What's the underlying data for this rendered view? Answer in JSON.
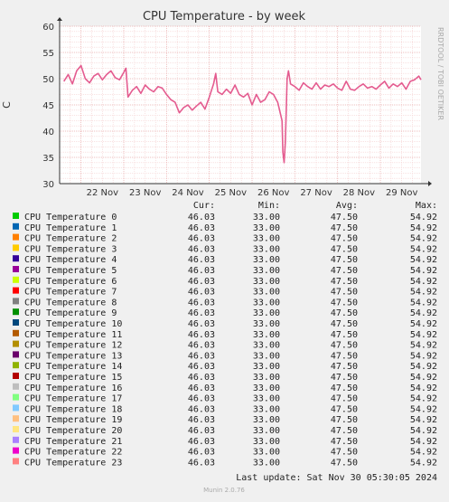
{
  "chart_data": {
    "type": "line",
    "title": "CPU Temperature - by week",
    "ylabel": "C",
    "side_label": "RRDTOOL / TOBI OETIKER",
    "ylim": [
      30,
      60
    ],
    "yticks": [
      30,
      35,
      40,
      45,
      50,
      55,
      60
    ],
    "x_categories": [
      "22 Nov",
      "23 Nov",
      "24 Nov",
      "25 Nov",
      "26 Nov",
      "27 Nov",
      "28 Nov",
      "29 Nov"
    ],
    "grid": true,
    "series_color": "#e45b8f",
    "series": [
      {
        "name": "CPU Temperature 23",
        "points": [
          [
            21.6,
            49.5
          ],
          [
            21.7,
            50.8
          ],
          [
            21.8,
            49.0
          ],
          [
            21.9,
            51.5
          ],
          [
            22.0,
            52.5
          ],
          [
            22.1,
            50.0
          ],
          [
            22.2,
            49.2
          ],
          [
            22.3,
            50.5
          ],
          [
            22.4,
            51.0
          ],
          [
            22.5,
            49.8
          ],
          [
            22.6,
            50.8
          ],
          [
            22.7,
            51.5
          ],
          [
            22.8,
            50.2
          ],
          [
            22.9,
            49.8
          ],
          [
            23.0,
            51.2
          ],
          [
            23.05,
            52.0
          ],
          [
            23.1,
            46.5
          ],
          [
            23.2,
            47.8
          ],
          [
            23.3,
            48.5
          ],
          [
            23.4,
            47.2
          ],
          [
            23.5,
            48.8
          ],
          [
            23.6,
            48.0
          ],
          [
            23.7,
            47.5
          ],
          [
            23.8,
            48.5
          ],
          [
            23.9,
            48.2
          ],
          [
            24.0,
            47.0
          ],
          [
            24.1,
            46.0
          ],
          [
            24.2,
            45.5
          ],
          [
            24.3,
            43.5
          ],
          [
            24.4,
            44.5
          ],
          [
            24.5,
            45.0
          ],
          [
            24.6,
            44.0
          ],
          [
            24.7,
            44.8
          ],
          [
            24.8,
            45.5
          ],
          [
            24.9,
            44.2
          ],
          [
            25.0,
            46.5
          ],
          [
            25.1,
            49.0
          ],
          [
            25.15,
            51.0
          ],
          [
            25.2,
            47.5
          ],
          [
            25.3,
            47.0
          ],
          [
            25.4,
            48.0
          ],
          [
            25.5,
            47.2
          ],
          [
            25.6,
            48.8
          ],
          [
            25.7,
            47.0
          ],
          [
            25.8,
            46.5
          ],
          [
            25.9,
            47.2
          ],
          [
            26.0,
            45.0
          ],
          [
            26.1,
            47.0
          ],
          [
            26.2,
            45.5
          ],
          [
            26.3,
            46.0
          ],
          [
            26.4,
            47.5
          ],
          [
            26.5,
            47.0
          ],
          [
            26.6,
            45.5
          ],
          [
            26.7,
            42.0
          ],
          [
            26.72,
            36.0
          ],
          [
            26.75,
            34.0
          ],
          [
            26.78,
            38.0
          ],
          [
            26.82,
            50.0
          ],
          [
            26.85,
            51.5
          ],
          [
            26.9,
            49.0
          ],
          [
            27.0,
            48.5
          ],
          [
            27.1,
            47.8
          ],
          [
            27.2,
            49.2
          ],
          [
            27.3,
            48.5
          ],
          [
            27.4,
            48.0
          ],
          [
            27.5,
            49.2
          ],
          [
            27.6,
            48.0
          ],
          [
            27.7,
            48.8
          ],
          [
            27.8,
            48.5
          ],
          [
            27.9,
            49.0
          ],
          [
            28.0,
            48.2
          ],
          [
            28.1,
            47.8
          ],
          [
            28.2,
            49.5
          ],
          [
            28.3,
            48.0
          ],
          [
            28.4,
            47.8
          ],
          [
            28.5,
            48.5
          ],
          [
            28.6,
            49.0
          ],
          [
            28.7,
            48.2
          ],
          [
            28.8,
            48.5
          ],
          [
            28.9,
            48.0
          ],
          [
            29.0,
            48.8
          ],
          [
            29.1,
            49.5
          ],
          [
            29.2,
            48.2
          ],
          [
            29.3,
            49.0
          ],
          [
            29.4,
            48.5
          ],
          [
            29.5,
            49.2
          ],
          [
            29.6,
            48.0
          ],
          [
            29.7,
            49.5
          ],
          [
            29.8,
            49.8
          ],
          [
            29.9,
            50.5
          ],
          [
            29.95,
            49.8
          ]
        ]
      }
    ]
  },
  "legend": {
    "col_cur": "Cur:",
    "col_min": "Min:",
    "col_avg": "Avg:",
    "col_max": "Max:",
    "rows": [
      {
        "name": "CPU Temperature 0",
        "color": "#00cc00",
        "cur": "46.03",
        "min": "33.00",
        "avg": "47.50",
        "max": "54.92"
      },
      {
        "name": "CPU Temperature 1",
        "color": "#0066b3",
        "cur": "46.03",
        "min": "33.00",
        "avg": "47.50",
        "max": "54.92"
      },
      {
        "name": "CPU Temperature 2",
        "color": "#ff8000",
        "cur": "46.03",
        "min": "33.00",
        "avg": "47.50",
        "max": "54.92"
      },
      {
        "name": "CPU Temperature 3",
        "color": "#ffcc00",
        "cur": "46.03",
        "min": "33.00",
        "avg": "47.50",
        "max": "54.92"
      },
      {
        "name": "CPU Temperature 4",
        "color": "#330099",
        "cur": "46.03",
        "min": "33.00",
        "avg": "47.50",
        "max": "54.92"
      },
      {
        "name": "CPU Temperature 5",
        "color": "#990099",
        "cur": "46.03",
        "min": "33.00",
        "avg": "47.50",
        "max": "54.92"
      },
      {
        "name": "CPU Temperature 6",
        "color": "#ccff00",
        "cur": "46.03",
        "min": "33.00",
        "avg": "47.50",
        "max": "54.92"
      },
      {
        "name": "CPU Temperature 7",
        "color": "#ff0000",
        "cur": "46.03",
        "min": "33.00",
        "avg": "47.50",
        "max": "54.92"
      },
      {
        "name": "CPU Temperature 8",
        "color": "#808080",
        "cur": "46.03",
        "min": "33.00",
        "avg": "47.50",
        "max": "54.92"
      },
      {
        "name": "CPU Temperature 9",
        "color": "#008f00",
        "cur": "46.03",
        "min": "33.00",
        "avg": "47.50",
        "max": "54.92"
      },
      {
        "name": "CPU Temperature 10",
        "color": "#00487d",
        "cur": "46.03",
        "min": "33.00",
        "avg": "47.50",
        "max": "54.92"
      },
      {
        "name": "CPU Temperature 11",
        "color": "#b35a00",
        "cur": "46.03",
        "min": "33.00",
        "avg": "47.50",
        "max": "54.92"
      },
      {
        "name": "CPU Temperature 12",
        "color": "#b38f00",
        "cur": "46.03",
        "min": "33.00",
        "avg": "47.50",
        "max": "54.92"
      },
      {
        "name": "CPU Temperature 13",
        "color": "#6b006b",
        "cur": "46.03",
        "min": "33.00",
        "avg": "47.50",
        "max": "54.92"
      },
      {
        "name": "CPU Temperature 14",
        "color": "#8fb300",
        "cur": "46.03",
        "min": "33.00",
        "avg": "47.50",
        "max": "54.92"
      },
      {
        "name": "CPU Temperature 15",
        "color": "#b30000",
        "cur": "46.03",
        "min": "33.00",
        "avg": "47.50",
        "max": "54.92"
      },
      {
        "name": "CPU Temperature 16",
        "color": "#bebebe",
        "cur": "46.03",
        "min": "33.00",
        "avg": "47.50",
        "max": "54.92"
      },
      {
        "name": "CPU Temperature 17",
        "color": "#80ff80",
        "cur": "46.03",
        "min": "33.00",
        "avg": "47.50",
        "max": "54.92"
      },
      {
        "name": "CPU Temperature 18",
        "color": "#80c9ff",
        "cur": "46.03",
        "min": "33.00",
        "avg": "47.50",
        "max": "54.92"
      },
      {
        "name": "CPU Temperature 19",
        "color": "#ffc080",
        "cur": "46.03",
        "min": "33.00",
        "avg": "47.50",
        "max": "54.92"
      },
      {
        "name": "CPU Temperature 20",
        "color": "#ffe680",
        "cur": "46.03",
        "min": "33.00",
        "avg": "47.50",
        "max": "54.92"
      },
      {
        "name": "CPU Temperature 21",
        "color": "#aa80ff",
        "cur": "46.03",
        "min": "33.00",
        "avg": "47.50",
        "max": "54.92"
      },
      {
        "name": "CPU Temperature 22",
        "color": "#ee00cc",
        "cur": "46.03",
        "min": "33.00",
        "avg": "47.50",
        "max": "54.92"
      },
      {
        "name": "CPU Temperature 23",
        "color": "#ff8080",
        "cur": "46.03",
        "min": "33.00",
        "avg": "47.50",
        "max": "54.92"
      }
    ]
  },
  "footer": {
    "last_update": "Last update:  Sat Nov 30 05:30:05 2024",
    "munin_version": "Munin 2.0.76"
  }
}
